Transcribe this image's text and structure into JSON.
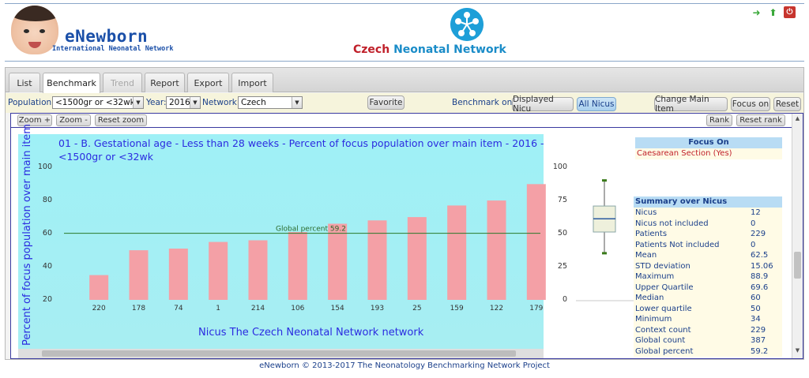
{
  "header": {
    "logo_title": "eNewborn",
    "logo_subtitle": "International Neonatal Network",
    "site_title_part1": "Czech",
    "site_title_part2": "Neonatal Network",
    "icons": [
      "exit-icon",
      "upload-icon",
      "power-icon"
    ]
  },
  "tabs": [
    {
      "label": "List",
      "state": "normal"
    },
    {
      "label": "Benchmark",
      "state": "active"
    },
    {
      "label": "Trend",
      "state": "disabled"
    },
    {
      "label": "Report",
      "state": "normal"
    },
    {
      "label": "Export",
      "state": "normal"
    },
    {
      "label": "Import",
      "state": "normal"
    }
  ],
  "toolbar": {
    "population_label": "Population:",
    "population_value": "<1500gr or <32wk",
    "year_label": "Year:",
    "year_value": "2016",
    "network_label": "Network:",
    "network_value": "Czech",
    "favorite": "Favorite",
    "benchmark_on": "Benchmark on",
    "displayed_nicu": "Displayed Nicu",
    "all_nicus": "All Nicus",
    "change_main_item": "Change Main Item",
    "focus_on": "Focus on",
    "reset": "Reset"
  },
  "zoombar": {
    "zoom_in": "Zoom +",
    "zoom_out": "Zoom -",
    "reset_zoom": "Reset zoom",
    "rank": "Rank",
    "reset_rank": "Reset rank"
  },
  "chart_data": {
    "type": "bar",
    "title": "01 - B. Gestational age - Less than 28 weeks - Percent of focus population over main item - 2016 - <1500gr or <32wk",
    "title_line1": "01 - B. Gestational age - Less than 28 weeks - Percent of focus population over main item - 2016 -",
    "title_line2": "<1500gr or <32wk",
    "xlabel": "Nicus The Czech Neonatal Network network",
    "ylabel": "Percent of focus population over main item",
    "categories": [
      "220",
      "178",
      "74",
      "1",
      "214",
      "106",
      "154",
      "193",
      "25",
      "159",
      "122",
      "179"
    ],
    "values": [
      34,
      49,
      50,
      54,
      55,
      60,
      65,
      67,
      69,
      76,
      79,
      88.9
    ],
    "ylim": [
      20,
      100
    ],
    "yticks": [
      20,
      40,
      60,
      80,
      100
    ],
    "reference_line": {
      "label": "Global percent 59.2",
      "value": 59.2
    },
    "bar_color": "#f4a0a6",
    "background": "#a3eef3",
    "boxplot": {
      "yticks": [
        0,
        25,
        50,
        75,
        100
      ],
      "min": 34,
      "q1": 50,
      "median": 60,
      "q3": 69.6,
      "max": 88.9
    }
  },
  "focus": {
    "header": "Focus On",
    "value": "Caesarean Section (Yes)"
  },
  "summary": {
    "header": "Summary over Nicus",
    "rows": [
      {
        "k": "Nicus",
        "v": "12"
      },
      {
        "k": "Nicus not included",
        "v": "0"
      },
      {
        "k": "Patients",
        "v": "229"
      },
      {
        "k": "Patients Not included",
        "v": "0"
      },
      {
        "k": "Mean",
        "v": "62.5"
      },
      {
        "k": "STD deviation",
        "v": "15.06"
      },
      {
        "k": "Maximum",
        "v": "88.9"
      },
      {
        "k": "Upper Quartile",
        "v": "69.6"
      },
      {
        "k": "Median",
        "v": "60"
      },
      {
        "k": "Lower quartile",
        "v": "50"
      },
      {
        "k": "Minimum",
        "v": "34"
      },
      {
        "k": "Context count",
        "v": "229"
      },
      {
        "k": "Global count",
        "v": "387"
      },
      {
        "k": "Global percent",
        "v": "59.2"
      }
    ]
  },
  "footer": "eNewborn © 2013-2017 The Neonatology Benchmarking Network Project"
}
